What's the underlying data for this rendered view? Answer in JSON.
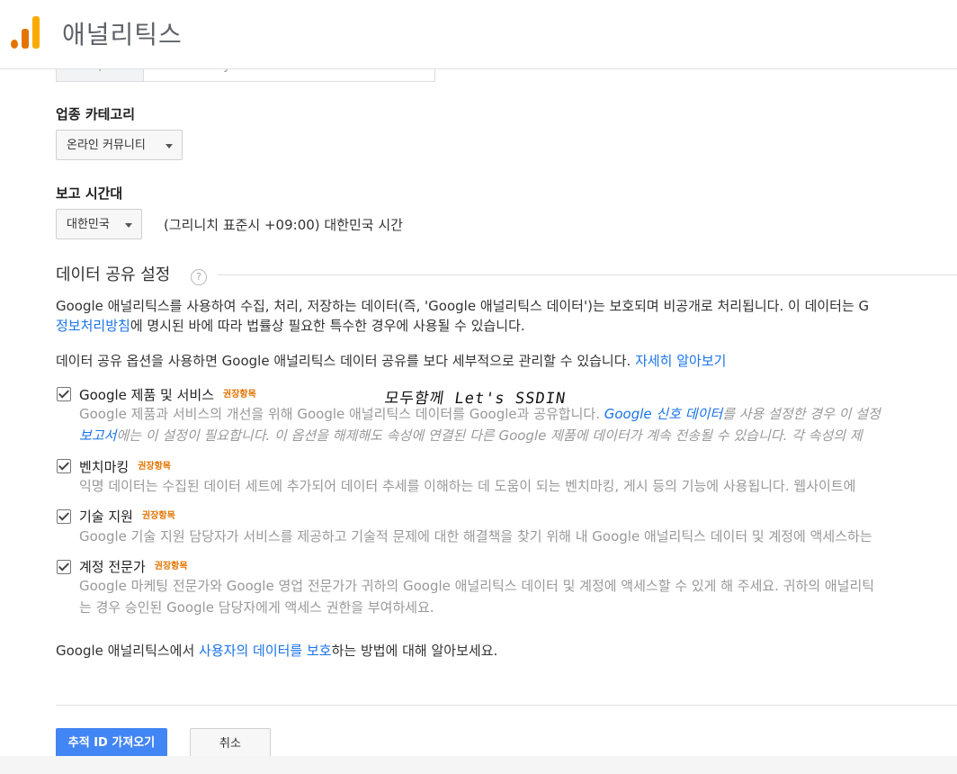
{
  "header": {
    "title": "애널리틱스",
    "logo": "analytics-logo"
  },
  "url_field": {
    "prefix": "http://",
    "value": "ssdin.tistory.com"
  },
  "industry": {
    "label": "업종 카테고리",
    "selected": "온라인 커뮤니티"
  },
  "timezone": {
    "label": "보고 시간대",
    "country": "대한민국",
    "description": "(그리니치 표준시 +09:00) 대한민국 시간"
  },
  "data_sharing": {
    "heading": "데이터 공유 설정",
    "help": "?",
    "intro": {
      "line1": "Google 애널리틱스를 사용하여 수집, 처리, 저장하는 데이터(즉, 'Google 애널리틱스 데이터')는 보호되며 비공개로 처리됩니다. 이 데이터는 G",
      "link": "정보처리방침",
      "line2_rest": "에 명시된 바에 따라 법률상 필요한 특수한 경우에 사용될 수 있습니다."
    },
    "options_note": "데이터 공유 옵션을 사용하면 Google 애널리틱스 데이터 공유를 보다 세부적으로 관리할 수 있습니다. ",
    "learn_more": "자세히 알아보기",
    "recommended": "권장항목",
    "options": [
      {
        "label": "Google 제품 및 서비스",
        "checked": true,
        "desc1_a": "Google 제품과 서비스의 개선을 위해 Google 애널리틱스 데이터를 Google과 공유합니다. ",
        "desc1_link": "Google 신호 데이터",
        "desc1_b": "를 사용 설정한 경우 이 설정",
        "desc2_link": "보고서",
        "desc2_b": "에는 이 설정이 필요합니다. 이 옵션을 해제해도 속성에 연결된 다른 Google 제품에 데이터가 계속 전송될 수 있습니다. 각 속성의 제"
      },
      {
        "label": "벤치마킹",
        "checked": true,
        "desc1": "익명 데이터는 수집된 데이터 세트에 추가되어 데이터 추세를 이해하는 데 도움이 되는 벤치마킹, 게시 등의 기능에 사용됩니다. 웹사이트에"
      },
      {
        "label": "기술 지원",
        "checked": true,
        "desc1": "Google 기술 지원 담당자가 서비스를 제공하고 기술적 문제에 대한 해결책을 찾기 위해 내 Google 애널리틱스 데이터 및 계정에 액세스하는"
      },
      {
        "label": "계정 전문가",
        "checked": true,
        "desc1": "Google 마케팅 전문가와 Google 영업 전문가가 귀하의 Google 애널리틱스 데이터 및 계정에 액세스할 수 있게 해 주세요. 귀하의 애널리틱",
        "desc2": "는 경우 승인된 Google 담당자에게 액세스 권한을 부여하세요."
      }
    ],
    "protect": {
      "before": "Google 애널리틱스에서 ",
      "link": "사용자의 데이터를 보호",
      "after": "하는 방법에 대해 알아보세요."
    }
  },
  "watermark": "모두함께 Let's SSDIN",
  "buttons": {
    "primary": "추적 ID 가져오기",
    "cancel": "취소"
  }
}
